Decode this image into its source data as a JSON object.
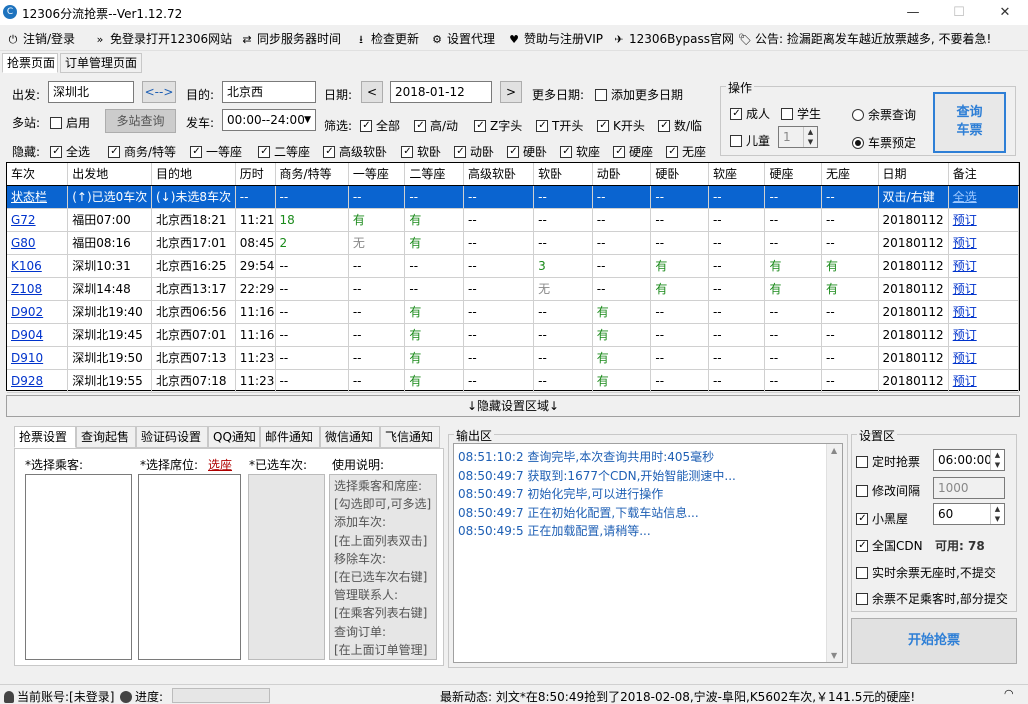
{
  "window": {
    "title": "12306分流抢票--Ver1.12.72",
    "app_icon": "C",
    "minimize": "—",
    "maximize": "☐",
    "close": "✕"
  },
  "toolbar": [
    {
      "icon": "⏻",
      "label": "注销/登录"
    },
    {
      "icon": "»",
      "label": "免登录打开12306网站"
    },
    {
      "icon": "⇄",
      "label": "同步服务器时间"
    },
    {
      "icon": "⭳",
      "label": "检查更新"
    },
    {
      "icon": "⚙",
      "label": "设置代理"
    },
    {
      "icon": "♥",
      "label": "赞助与注册VIP"
    },
    {
      "icon": "✈",
      "label": "12306Bypass官网"
    },
    {
      "icon": "🏷",
      "label": "公告: 捡漏距离发车越近放票越多, 不要着急!"
    }
  ],
  "tabs": [
    "抢票页面",
    "订单管理页面"
  ],
  "query": {
    "from_label": "出发:",
    "from_value": "深圳北",
    "swap_label": "<-->",
    "to_label": "目的:",
    "to_value": "北京西",
    "date_label": "日期:",
    "date_value": "2018-01-12",
    "prev": "<",
    "next": ">",
    "more_dates_label": "更多日期:",
    "add_more_dates": "添加更多日期",
    "multi_station_label": "多站:",
    "enable_label": "启用",
    "multi_query_btn": "多站查询",
    "depart_label": "发车:",
    "depart_value": "00:00--24:00",
    "filter_label": "筛选:",
    "filters": [
      {
        "label": "全部",
        "checked": true
      },
      {
        "label": "高/动",
        "checked": true
      },
      {
        "label": "Z字头",
        "checked": true
      },
      {
        "label": "T开头",
        "checked": true
      },
      {
        "label": "K开头",
        "checked": true
      },
      {
        "label": "数/临",
        "checked": true
      }
    ],
    "hide_label": "隐藏:",
    "hides": [
      {
        "label": "全选",
        "checked": true
      },
      {
        "label": "商务/特等",
        "checked": true
      },
      {
        "label": "一等座",
        "checked": true
      },
      {
        "label": "二等座",
        "checked": true
      },
      {
        "label": "高级软卧",
        "checked": true
      },
      {
        "label": "软卧",
        "checked": true
      },
      {
        "label": "动卧",
        "checked": true
      },
      {
        "label": "硬卧",
        "checked": true
      },
      {
        "label": "软座",
        "checked": true
      },
      {
        "label": "硬座",
        "checked": true
      },
      {
        "label": "无座",
        "checked": true
      }
    ]
  },
  "operation": {
    "title": "操作",
    "adult": "成人",
    "adult_checked": true,
    "student": "学生",
    "student_checked": false,
    "child": "儿童",
    "child_checked": false,
    "child_count": "1",
    "remaining_query": "余票查询",
    "remaining_selected": false,
    "ticket_booking": "车票预定",
    "booking_selected": true,
    "query_button": "查询\n车票"
  },
  "table": {
    "headers": [
      "车次",
      "出发地",
      "目的地",
      "历时",
      "商务/特等",
      "一等座",
      "二等座",
      "高级软卧",
      "软卧",
      "动卧",
      "硬卧",
      "软座",
      "硬座",
      "无座",
      "日期",
      "备注"
    ],
    "status_row": [
      "状态栏",
      "(↑)已选0车次",
      "(↓)未选8车次",
      "--",
      "--",
      "--",
      "--",
      "--",
      "--",
      "--",
      "--",
      "--",
      "--",
      "--",
      "双击/右键",
      "全选"
    ],
    "rows": [
      [
        "G72",
        "福田07:00",
        "北京西18:21",
        "11:21",
        "18",
        "有",
        "有",
        "--",
        "--",
        "--",
        "--",
        "--",
        "--",
        "--",
        "20180112",
        "预订"
      ],
      [
        "G80",
        "福田08:16",
        "北京西17:01",
        "08:45",
        "2",
        "无",
        "有",
        "--",
        "--",
        "--",
        "--",
        "--",
        "--",
        "--",
        "20180112",
        "预订"
      ],
      [
        "K106",
        "深圳10:31",
        "北京西16:25",
        "29:54",
        "--",
        "--",
        "--",
        "--",
        "3",
        "--",
        "有",
        "--",
        "有",
        "有",
        "20180112",
        "预订"
      ],
      [
        "Z108",
        "深圳14:48",
        "北京西13:17",
        "22:29",
        "--",
        "--",
        "--",
        "--",
        "无",
        "--",
        "有",
        "--",
        "有",
        "有",
        "20180112",
        "预订"
      ],
      [
        "D902",
        "深圳北19:40",
        "北京西06:56",
        "11:16",
        "--",
        "--",
        "有",
        "--",
        "--",
        "有",
        "--",
        "--",
        "--",
        "--",
        "20180112",
        "预订"
      ],
      [
        "D904",
        "深圳北19:45",
        "北京西07:01",
        "11:16",
        "--",
        "--",
        "有",
        "--",
        "--",
        "有",
        "--",
        "--",
        "--",
        "--",
        "20180112",
        "预订"
      ],
      [
        "D910",
        "深圳北19:50",
        "北京西07:13",
        "11:23",
        "--",
        "--",
        "有",
        "--",
        "--",
        "有",
        "--",
        "--",
        "--",
        "--",
        "20180112",
        "预订"
      ],
      [
        "D928",
        "深圳北19:55",
        "北京西07:18",
        "11:23",
        "--",
        "--",
        "有",
        "--",
        "--",
        "有",
        "--",
        "--",
        "--",
        "--",
        "20180112",
        "预订"
      ]
    ]
  },
  "hide_settings": "↓隐藏设置区域↓",
  "bottom_tabs": [
    "抢票设置",
    "查询起售",
    "验证码设置",
    "QQ通知",
    "邮件通知",
    "微信通知",
    "飞信通知"
  ],
  "grab": {
    "passenger_label": "*选择乘客:",
    "seat_label": "*选择席位:",
    "seat_link": "选座",
    "train_label": "*已选车次:",
    "usage_label": "使用说明:",
    "usage_lines": [
      "选择乘客和席座:",
      "[勾选即可,可多选]",
      "添加车次:",
      "[在上面列表双击]",
      "移除车次:",
      "[在已选车次右键]",
      "管理联系人:",
      "[在乘客列表右键]",
      "查询订单:",
      "[在上面订单管理]"
    ]
  },
  "output": {
    "title": "输出区",
    "lines": [
      "08:51:10:2  查询完毕,本次查询共用时:405毫秒",
      "08:50:49:7  获取到:1677个CDN,开始智能测速中...",
      "08:50:49:7  初始化完毕,可以进行操作",
      "08:50:49:7  正在初始化配置,下载车站信息...",
      "08:50:49:5  正在加载配置,请稍等..."
    ]
  },
  "settings": {
    "title": "设置区",
    "timed": "定时抢票",
    "timed_checked": false,
    "timed_value": "06:00:00",
    "interval": "修改间隔",
    "interval_checked": false,
    "interval_value": "1000",
    "blackroom": "小黑屋",
    "blackroom_checked": true,
    "blackroom_value": "60",
    "cdn": "全国CDN",
    "cdn_checked": true,
    "cdn_available_label": "可用:",
    "cdn_available": "78",
    "realtime": "实时余票无座时,不提交",
    "realtime_checked": false,
    "partial": "余票不足乘客时,部分提交",
    "partial_checked": false,
    "start_button": "开始抢票"
  },
  "status": {
    "account": "当前账号:[未登录]",
    "progress_label": "进度:",
    "news": "最新动态: 刘文*在8:50:49抢到了2018-02-08,宁波-阜阳,K5602车次,￥141.5元的硬座!"
  },
  "colors": {
    "selected_row": "#0a64d0",
    "green_value": "#1a8a1a",
    "link": "#0033cc",
    "log_text": "#1e5fb4",
    "accent_button": "#2e7fd6"
  }
}
